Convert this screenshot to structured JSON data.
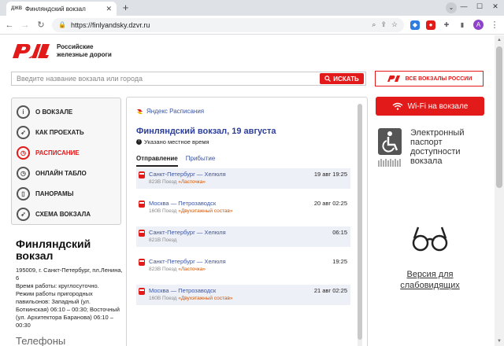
{
  "browser": {
    "tab_favicon": "ДЖВ",
    "tab_title": "Финляндский вокзал",
    "tab_close": "✕",
    "new_tab": "+",
    "url": "https://finlyandsky.dzvr.ru",
    "profile_initial": "A"
  },
  "header": {
    "logo_line1": "Российские",
    "logo_line2": "железные дороги"
  },
  "search": {
    "placeholder": "Введите название вокзала или города",
    "button_label": "ИСКАТЬ"
  },
  "all_stations_label": "ВСЕ ВОКЗАЛЫ РОССИИ",
  "menu": {
    "items": [
      {
        "label": "О ВОКЗАЛЕ",
        "icon": "info-icon"
      },
      {
        "label": "КАК ПРОЕХАТЬ",
        "icon": "compass-icon"
      },
      {
        "label": "РАСПИСАНИЕ",
        "icon": "clock-icon"
      },
      {
        "label": "ОНЛАЙН ТАБЛО",
        "icon": "board-icon"
      },
      {
        "label": "ПАНОРАМЫ",
        "icon": "panorama-icon"
      },
      {
        "label": "СХЕМА ВОКЗАЛА",
        "icon": "map-icon"
      }
    ],
    "active_index": 2
  },
  "station": {
    "title": "Финляндский вокзал",
    "address": "195009, г. Санкт-Петербург, пл.Ленина, 6",
    "hours": "Время работы: круглосуточно.",
    "suburban": "Режим работы пригородных павильонов: Западный (ул. Боткинская) 06:10 – 00:30; Восточный (ул. Архитектора Баранова) 06:10 – 00:30",
    "phones_heading": "Телефоны"
  },
  "widget": {
    "brand": "Яндекс Расписания",
    "title": "Финляндский вокзал, 19 августа",
    "note": "Указано местное время",
    "tabs": [
      "Отправление",
      "Прибытие"
    ],
    "trips": [
      {
        "route": "Санкт-Петербург — Хелюля",
        "train": "823В Поезд",
        "brand": "«Ласточка»",
        "time": "19 авг 19:25"
      },
      {
        "route": "Москва — Петрозаводск",
        "train": "160В Поезд",
        "brand": "«Двухэтажный состав»",
        "time": "20 авг 02:25"
      },
      {
        "route": "Санкт-Петербург — Хелюля",
        "train": "821В Поезд",
        "brand": "",
        "time": "06:15"
      },
      {
        "route": "Санкт-Петербург — Хелюля",
        "train": "823В Поезд",
        "brand": "«Ласточка»",
        "time": "19:25"
      },
      {
        "route": "Москва — Петрозаводск",
        "train": "160В Поезд",
        "brand": "«Двухэтажный состав»",
        "time": "21 авг 02:25"
      }
    ]
  },
  "right": {
    "wifi_label": "Wi-Fi на вокзале",
    "passport": [
      "Электронный",
      "паспорт",
      "доступности",
      "вокзала"
    ],
    "low_vision": "Версия для слабовидящих"
  },
  "colors": {
    "brand_red": "#e21a1a",
    "link_blue": "#3a55a6"
  }
}
